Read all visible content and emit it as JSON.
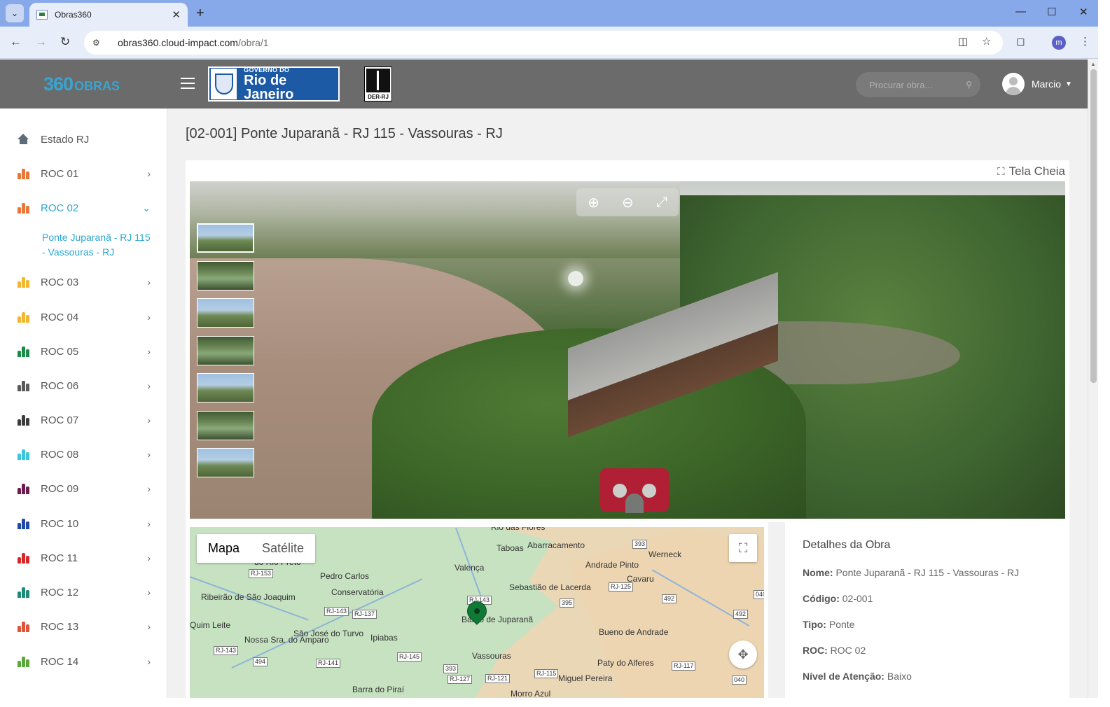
{
  "browser": {
    "tab_title": "Obras360",
    "url_host": "obras360.cloud-impact.com",
    "url_path": "/obra/1",
    "profile_initial": "m"
  },
  "header": {
    "logo_num": "360",
    "logo_text": "OBRAS",
    "gov_line1": "GOVERNO DO",
    "gov_line2": "Rio de Janeiro",
    "der_label": "DER-RJ",
    "search_placeholder": "Procurar obra...",
    "user_name": "Marcio"
  },
  "sidebar": {
    "home_label": "Estado RJ",
    "items": [
      {
        "label": "ROC 01",
        "color": "#e8773a"
      },
      {
        "label": "ROC 02",
        "color": "#e8773a"
      },
      {
        "label": "ROC 03",
        "color": "#f2b632"
      },
      {
        "label": "ROC 04",
        "color": "#f2b632"
      },
      {
        "label": "ROC 05",
        "color": "#1e8a4a"
      },
      {
        "label": "ROC 06",
        "color": "#5a5a5a"
      },
      {
        "label": "ROC 07",
        "color": "#3c3c3c"
      },
      {
        "label": "ROC 08",
        "color": "#38c6e0"
      },
      {
        "label": "ROC 09",
        "color": "#6a1e4e"
      },
      {
        "label": "ROC 10",
        "color": "#2349a8"
      },
      {
        "label": "ROC 11",
        "color": "#d62828"
      },
      {
        "label": "ROC 12",
        "color": "#1f8a78"
      },
      {
        "label": "ROC 13",
        "color": "#e0553a"
      },
      {
        "label": "ROC 14",
        "color": "#5aa83c"
      }
    ],
    "sub_item": "Ponte Juparanã - RJ 115 - Vassouras - RJ"
  },
  "main": {
    "title": "[02-001] Ponte Juparanã - RJ 115 - Vassouras - RJ",
    "fullscreen_label": "Tela Cheia"
  },
  "map": {
    "tab_map": "Mapa",
    "tab_satellite": "Satélite",
    "labels": [
      {
        "text": "Rio das Flores"
      },
      {
        "text": "Taboas"
      },
      {
        "text": "Abarracamento"
      },
      {
        "text": "Andrade Pinto"
      },
      {
        "text": "Werneck"
      },
      {
        "text": "Valença"
      },
      {
        "text": "Pedro Carlos"
      },
      {
        "text": "Sebastião de Lacerda"
      },
      {
        "text": "Cavaru"
      },
      {
        "text": "Conservatória"
      },
      {
        "text": "Ribeirão de São Joaquim"
      },
      {
        "text": "Barão de Juparanã"
      },
      {
        "text": "Quim Leite"
      },
      {
        "text": "São José do Turvo"
      },
      {
        "text": "Nossa Sra. do Amparo"
      },
      {
        "text": "Ipiabas"
      },
      {
        "text": "Bueno de Andrade"
      },
      {
        "text": "Vassouras"
      },
      {
        "text": "Paty do Alferes"
      },
      {
        "text": "Miguel Pereira"
      },
      {
        "text": "Barra do Piraí"
      },
      {
        "text": "Morro Azul"
      },
      {
        "text": "do Rio Preto"
      }
    ],
    "shields": [
      "RJ-153",
      "RJ-143",
      "RJ-137",
      "RJ-143",
      "RJ-143",
      "RJ-145",
      "RJ-141",
      "494",
      "393",
      "RJ-125",
      "395",
      "492",
      "040",
      "492",
      "RJ-117",
      "RJ-115",
      "RJ-127",
      "RJ-121",
      "040",
      "393"
    ]
  },
  "details": {
    "title": "Detalhes da Obra",
    "rows": [
      {
        "key": "Nome:",
        "value": "Ponte Juparanã - RJ 115 - Vassouras - RJ"
      },
      {
        "key": "Código:",
        "value": "02-001"
      },
      {
        "key": "Tipo:",
        "value": "Ponte"
      },
      {
        "key": "ROC:",
        "value": "ROC 02"
      },
      {
        "key": "Nível de Atenção:",
        "value": "Baixo"
      }
    ]
  }
}
